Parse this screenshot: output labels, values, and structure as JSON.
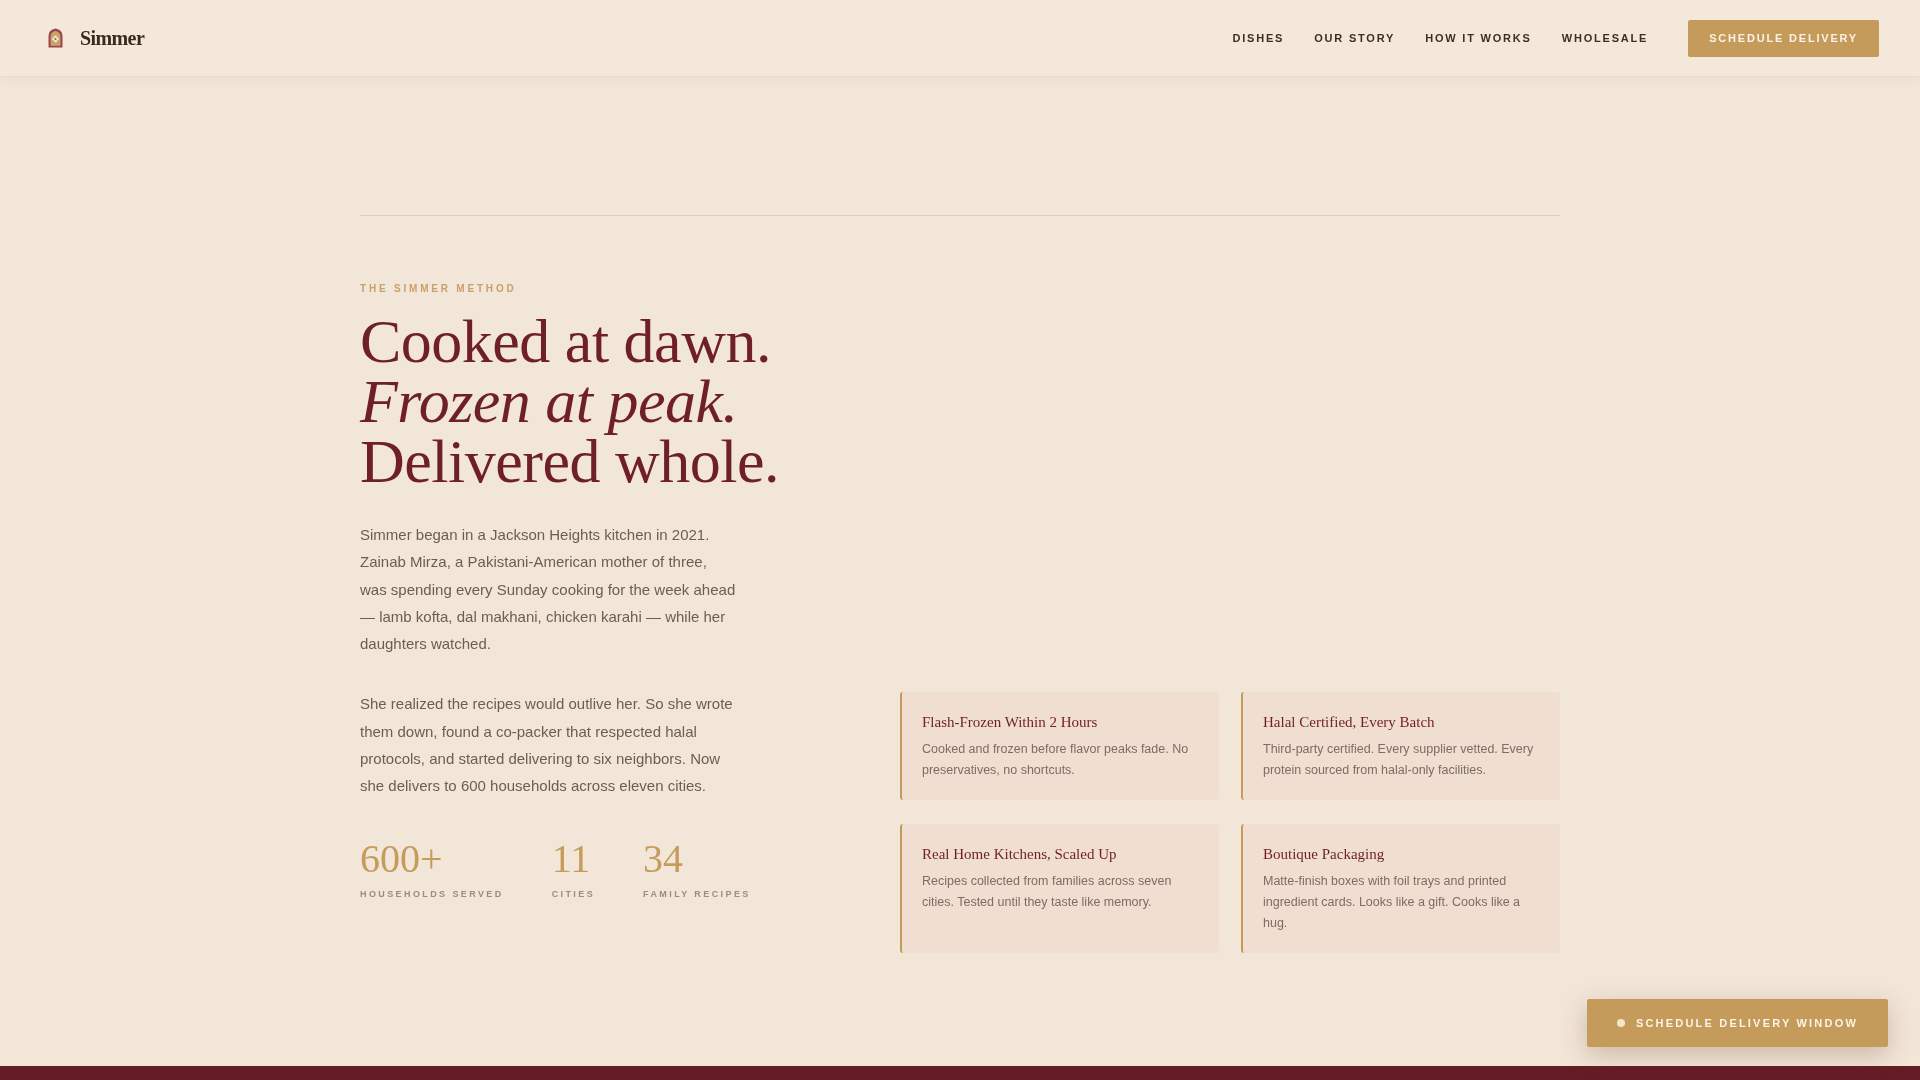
{
  "header": {
    "brand": "Simmer",
    "nav": [
      {
        "label": "DISHES"
      },
      {
        "label": "OUR STORY"
      },
      {
        "label": "HOW IT WORKS"
      },
      {
        "label": "WHOLESALE"
      }
    ],
    "cta": "SCHEDULE DELIVERY"
  },
  "hero": {
    "eyebrow": "THE SIMMER METHOD",
    "headline": [
      {
        "text": "Cooked at dawn.",
        "italic": false
      },
      {
        "text": "Frozen at peak.",
        "italic": true
      },
      {
        "text": "Delivered whole.",
        "italic": false
      }
    ],
    "paragraphs": [
      "Simmer began in a Jackson Heights kitchen in 2021. Zainab Mirza, a Pakistani-American mother of three, was spending every Sunday cooking for the week ahead — lamb kofta, dal makhani, chicken karahi — while her daughters watched.",
      "She realized the recipes would outlive her. So she wrote them down, found a co-packer that respected halal protocols, and started delivering to six neighbors. Now she delivers to 600 households across eleven cities."
    ],
    "stats": [
      {
        "value": "600+",
        "label": "HOUSEHOLDS SERVED"
      },
      {
        "value": "11",
        "label": "CITIES"
      },
      {
        "value": "34",
        "label": "FAMILY RECIPES"
      }
    ]
  },
  "features": [
    {
      "title": "Flash-Frozen Within 2 Hours",
      "description": "Cooked and frozen before flavor peaks fade. No preservatives, no shortcuts."
    },
    {
      "title": "Halal Certified, Every Batch",
      "description": "Third-party certified. Every supplier vetted. Every protein sourced from halal-only facilities."
    },
    {
      "title": "Real Home Kitchens, Scaled Up",
      "description": "Recipes collected from families across seven cities. Tested until they taste like memory."
    },
    {
      "title": "Boutique Packaging",
      "description": "Matte-finish boxes with foil trays and printed ingredient cards. Looks like a gift. Cooks like a hug."
    }
  ],
  "floating_button": {
    "label": "SCHEDULE DELIVERY WINDOW"
  }
}
